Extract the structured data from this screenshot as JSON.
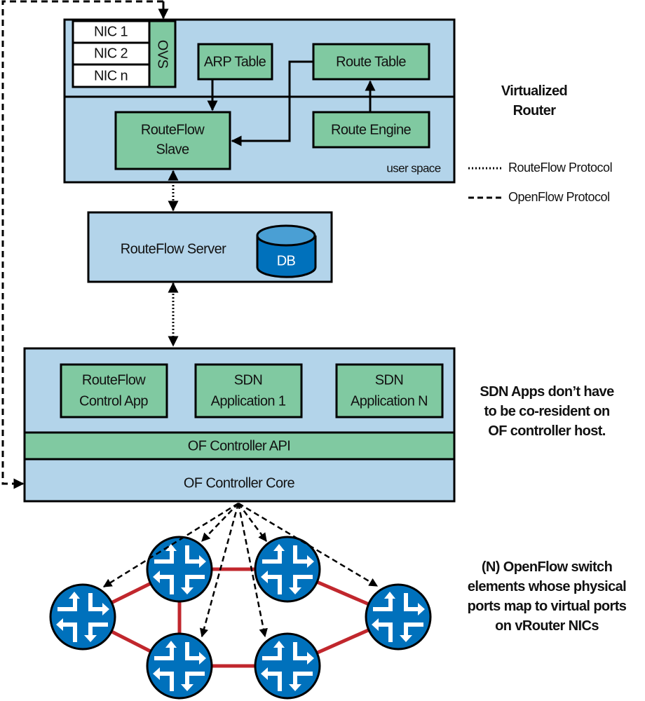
{
  "colors": {
    "container": "#b3d4ea",
    "component": "#80c9a1",
    "switch": "#0071bc",
    "link": "#c1272d",
    "db_top": "#4a9fd4"
  },
  "virtual_router": {
    "nics": [
      "NIC 1",
      "NIC 2",
      "NIC n"
    ],
    "ovs": "OVS",
    "arp_table": "ARP Table",
    "route_table": "Route Table",
    "routeflow_slave": [
      "RouteFlow",
      "Slave"
    ],
    "route_engine": "Route Engine",
    "user_space": "user space",
    "label": [
      "Virtualized",
      "Router"
    ]
  },
  "legend": {
    "routeflow": "RouteFlow Protocol",
    "openflow": "OpenFlow Protocol"
  },
  "server": {
    "label": "RouteFlow Server",
    "db": "DB"
  },
  "controller": {
    "apps": [
      [
        "RouteFlow",
        "Control App"
      ],
      [
        "SDN",
        "Application 1"
      ],
      [
        "SDN",
        "Application N"
      ]
    ],
    "api": "OF Controller API",
    "core": "OF Controller Core",
    "note": [
      "SDN Apps don’t have",
      "to be co-resident on",
      "OF controller host."
    ]
  },
  "switches": {
    "note": [
      "(N) OpenFlow switch",
      "elements whose physical",
      "ports map to virtual ports",
      "on vRouter NICs"
    ]
  }
}
